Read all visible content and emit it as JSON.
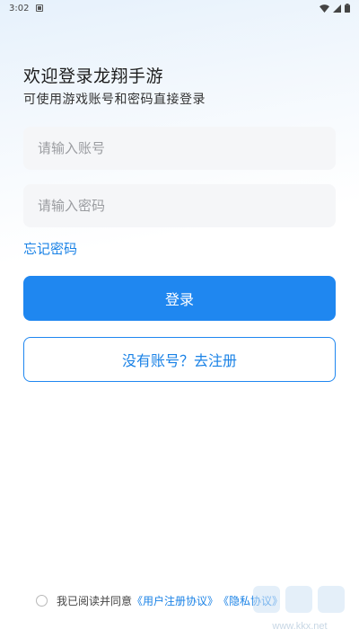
{
  "status_bar": {
    "time": "3:02"
  },
  "header": {
    "title": "欢迎登录龙翔手游",
    "subtitle": "可使用游戏账号和密码直接登录"
  },
  "form": {
    "account_placeholder": "请输入账号",
    "password_placeholder": "请输入密码",
    "forgot_password": "忘记密码",
    "login_label": "登录",
    "register_label": "没有账号？去注册"
  },
  "agreement": {
    "prefix": "我已阅读并同意",
    "user_agreement": "《用户注册协议》",
    "privacy_agreement": "《隐私协议》"
  },
  "watermark": {
    "text": "www.kkx.net"
  },
  "colors": {
    "accent": "#1f87f0",
    "link": "#1a82e6",
    "input_bg": "#f5f6f8"
  }
}
